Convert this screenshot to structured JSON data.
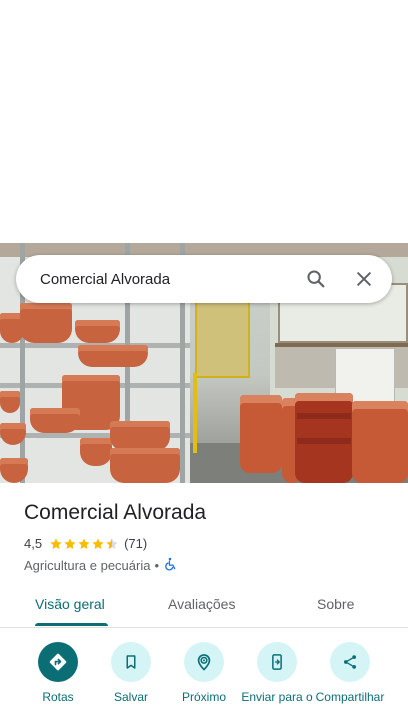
{
  "search": {
    "query": "Comercial Alvorada",
    "search_icon": "search-icon",
    "close_icon": "close-icon"
  },
  "place": {
    "title": "Comercial Alvorada",
    "rating": "4,5",
    "rating_value": 4.5,
    "review_count": "(71)",
    "category": "Agricultura e pecuária",
    "separator": "•",
    "accessibility_icon": "wheelchair-icon"
  },
  "tabs": [
    {
      "label": "Visão geral",
      "active": true
    },
    {
      "label": "Avaliações",
      "active": false
    },
    {
      "label": "Sobre",
      "active": false
    }
  ],
  "actions": [
    {
      "label": "Rotas",
      "icon": "directions-icon"
    },
    {
      "label": "Salvar",
      "icon": "bookmark-icon"
    },
    {
      "label": "Próximo",
      "icon": "nearby-icon"
    },
    {
      "label": "Enviar para o",
      "icon": "send-to-phone-icon"
    },
    {
      "label": "Compartilhar",
      "icon": "share-icon"
    }
  ],
  "colors": {
    "accent": "#0b6e75",
    "accent_light": "#d4f4f6",
    "star": "#fbbc04"
  }
}
